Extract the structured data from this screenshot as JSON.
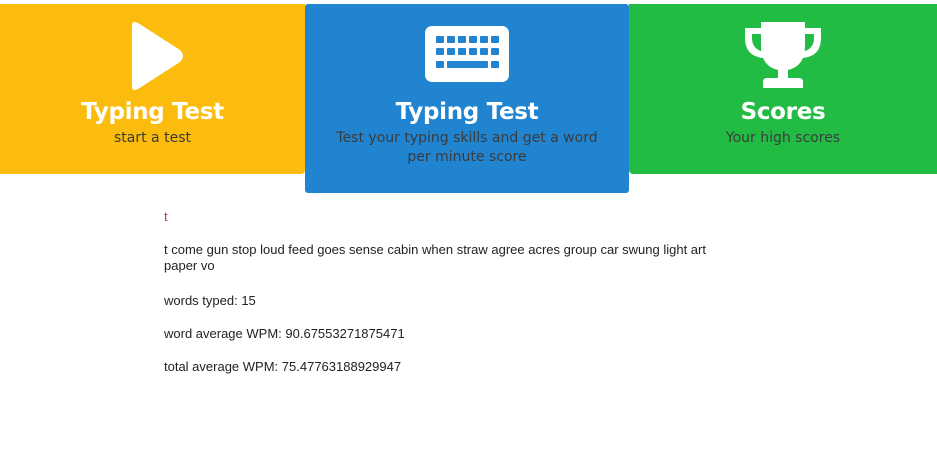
{
  "nav": {
    "start": {
      "title": "Typing Test",
      "subtitle": "start a test",
      "icon": "play-icon",
      "color": "#fbbc0d"
    },
    "test": {
      "title": "Typing Test",
      "subtitle": "Test your typing skills and get a word per minute score",
      "icon": "keyboard-icon",
      "color": "#2184d1"
    },
    "scores": {
      "title": "Scores",
      "subtitle": "Your high scores",
      "icon": "trophy-icon",
      "color": "#22bc45"
    }
  },
  "test": {
    "typed": "t",
    "remaining": "t come gun stop loud feed goes sense cabin when straw agree acres group car swung light art paper vo",
    "words_typed_label": "words typed:",
    "words_typed": "15",
    "word_avg_label": "word average WPM:",
    "word_avg": "90.67553271875471",
    "total_avg_label": "total average WPM:",
    "total_avg": "75.47763188929947"
  }
}
